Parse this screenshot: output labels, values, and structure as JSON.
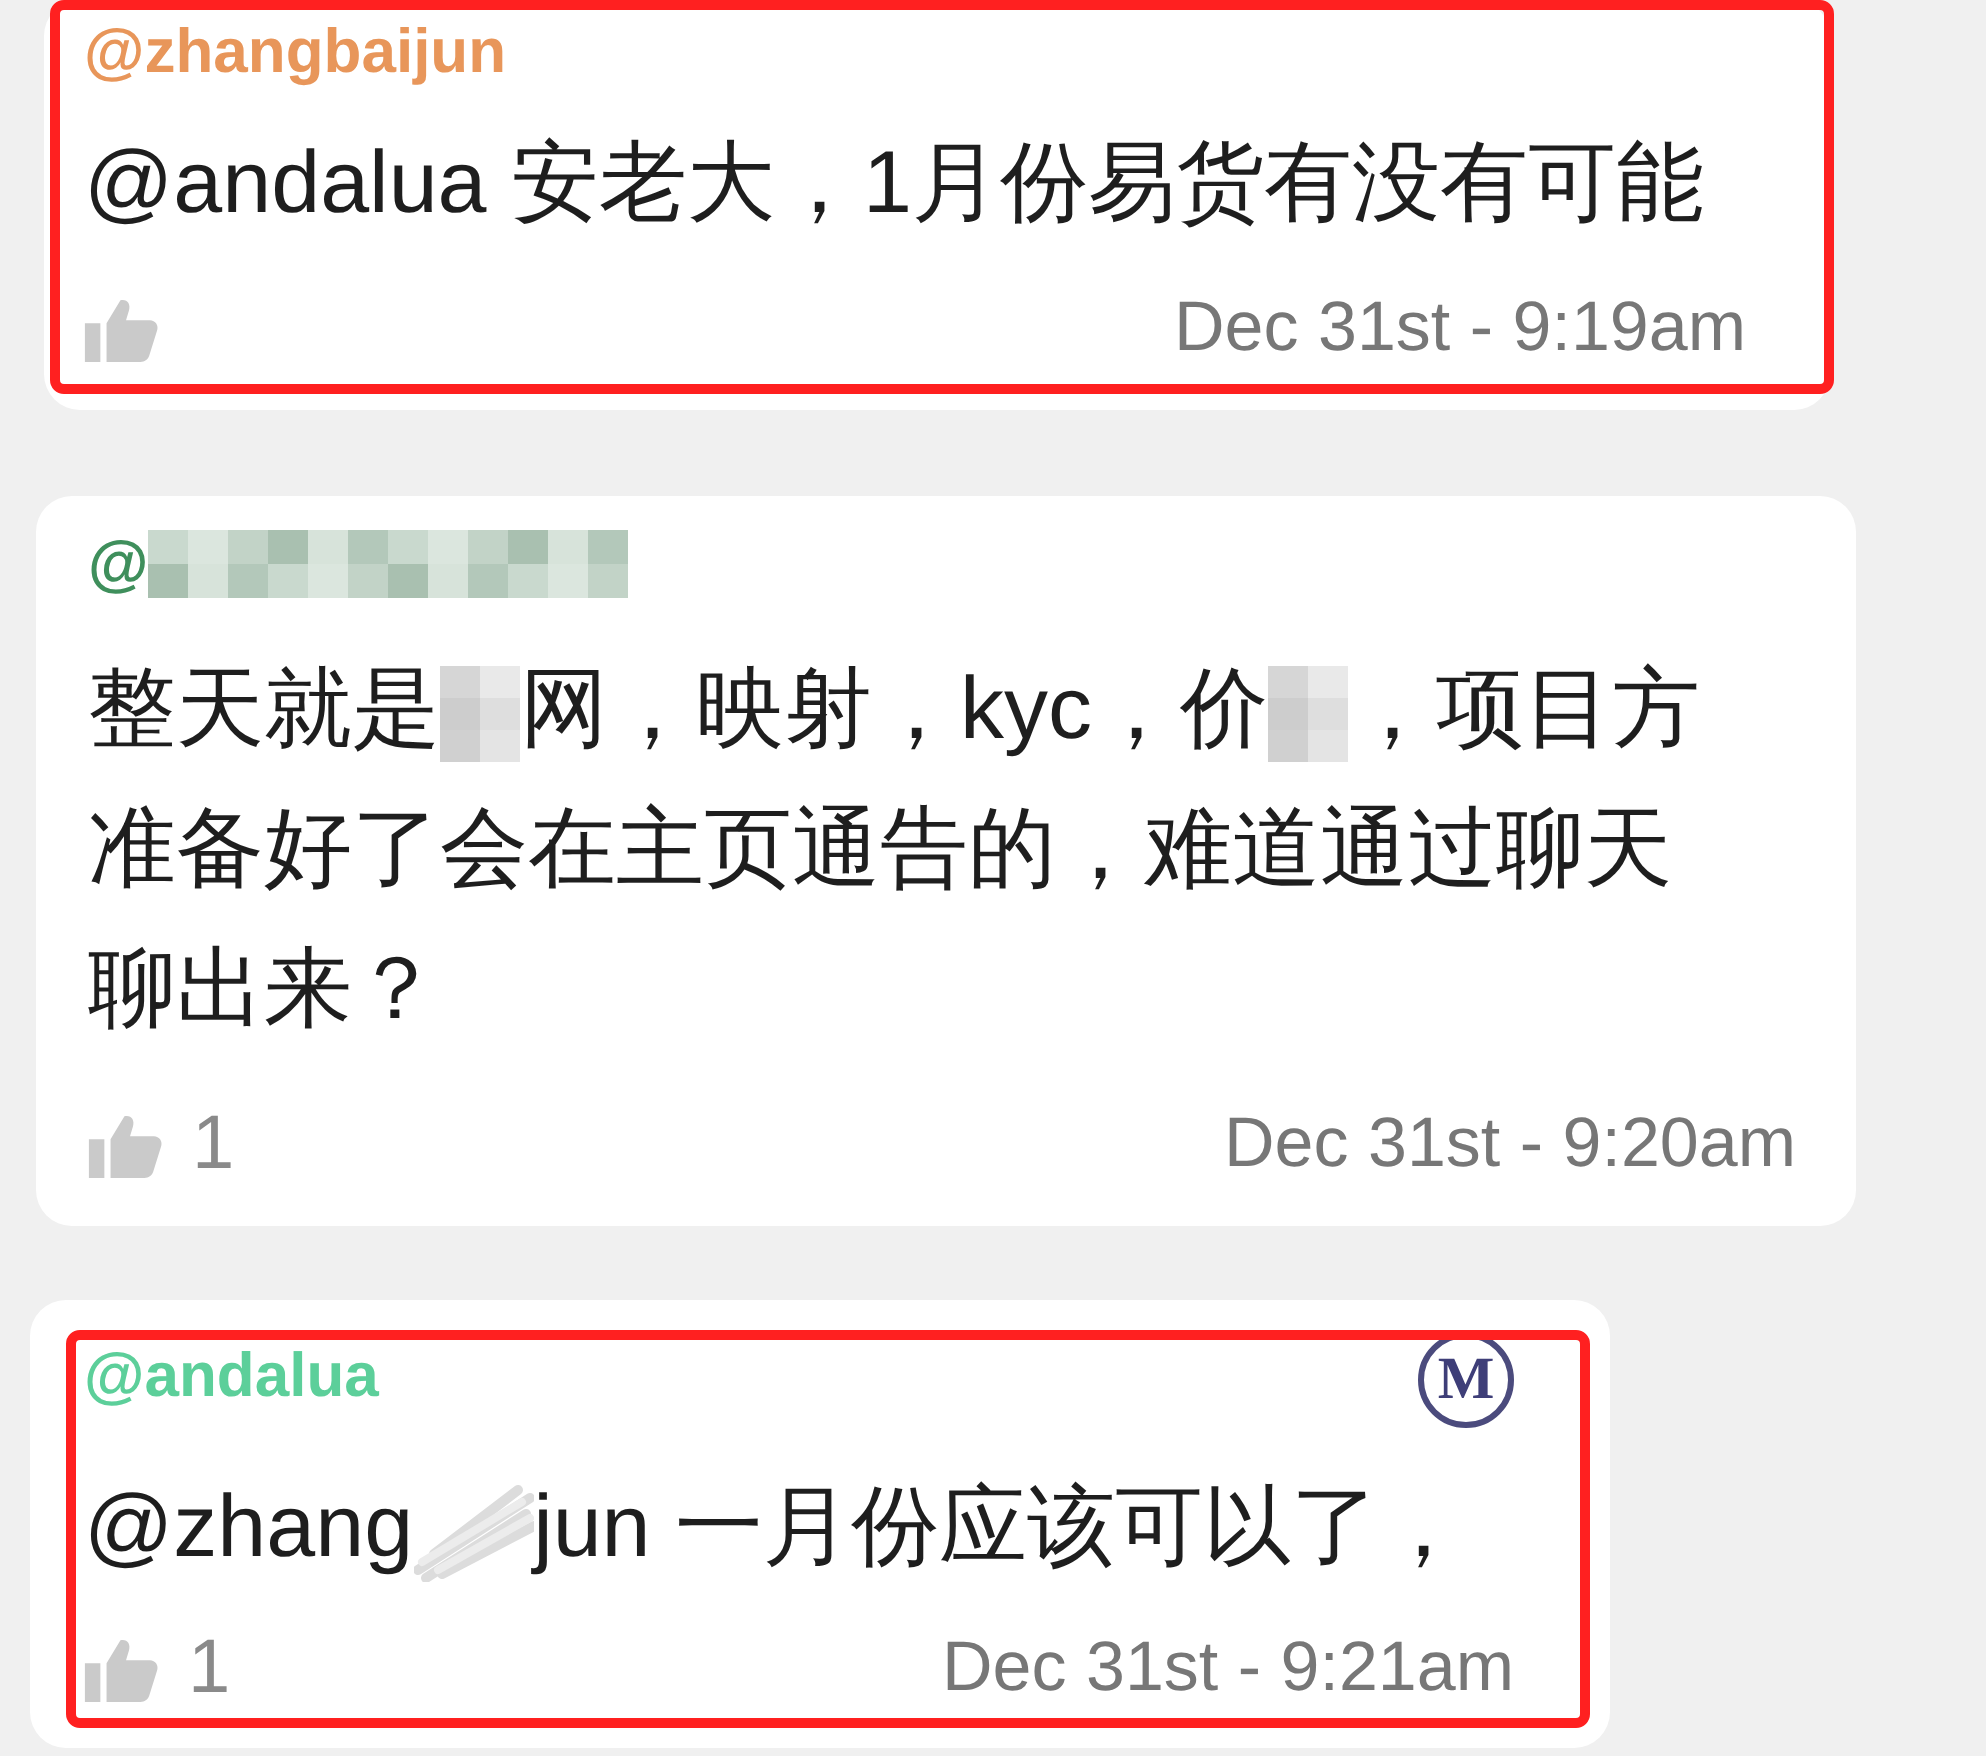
{
  "messages": [
    {
      "author": {
        "color": "#e8965a",
        "parts": [
          {
            "kind": "text",
            "text": "@zhangbaijun"
          }
        ]
      },
      "body": [
        [
          {
            "kind": "text",
            "text": "@andalua 安老大，1月份易货有没有可能"
          }
        ]
      ],
      "time": "Dec 31st - 9:19am",
      "highlighted": true
    },
    {
      "author": {
        "color": "#3f8f5c",
        "parts": [
          {
            "kind": "text",
            "text": "@"
          },
          {
            "kind": "blur"
          }
        ]
      },
      "body": [
        [
          {
            "kind": "text",
            "text": "整天就是"
          },
          {
            "kind": "blur"
          },
          {
            "kind": "text",
            "text": "网，映射，kyc，价"
          },
          {
            "kind": "blur"
          },
          {
            "kind": "text",
            "text": "，项目方"
          }
        ],
        [
          {
            "kind": "text",
            "text": "准备好了会在主页通告的，难道通过聊天"
          }
        ],
        [
          {
            "kind": "text",
            "text": "聊出来？"
          }
        ]
      ],
      "likes": "1",
      "time": "Dec 31st - 9:20am",
      "highlighted": false
    },
    {
      "author": {
        "color": "#5ccf9a",
        "parts": [
          {
            "kind": "text",
            "text": "@andalua"
          }
        ]
      },
      "badge": "M",
      "body": [
        [
          {
            "kind": "text",
            "text": "@zhang"
          },
          {
            "kind": "scribble"
          },
          {
            "kind": "text",
            "text": "jun 一月份应该可以了，"
          }
        ]
      ],
      "likes": "1",
      "time": "Dec 31st - 9:21am",
      "highlighted": true
    }
  ]
}
